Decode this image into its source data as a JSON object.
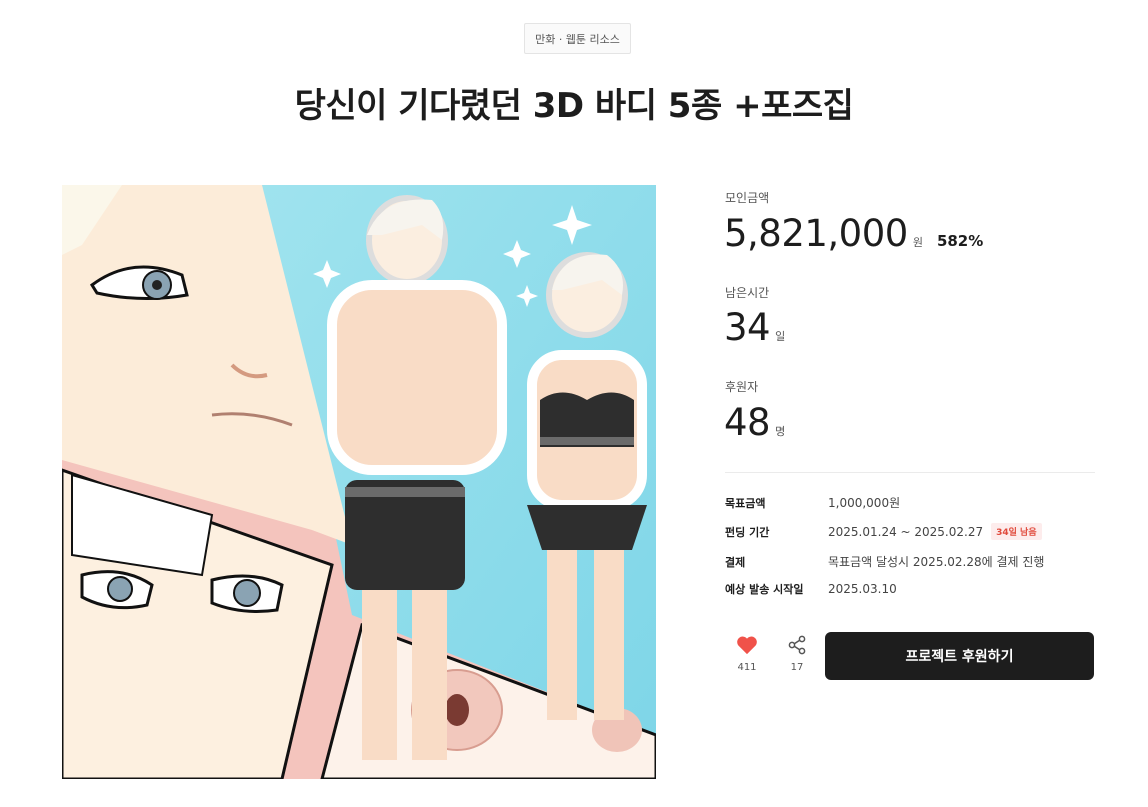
{
  "category": "만화 · 웹툰 리소스",
  "title": "당신이 기다렸던 3D 바디 5종 +포즈집",
  "stats": {
    "funding_label": "모인금액",
    "funding_amount": "5,821,000",
    "funding_unit": "원",
    "funding_percent": "582%",
    "time_label": "남은시간",
    "time_value": "34",
    "time_unit": "일",
    "backers_label": "후원자",
    "backers_value": "48",
    "backers_unit": "명"
  },
  "info": {
    "goal_key": "목표금액",
    "goal_val": "1,000,000원",
    "period_key": "펀딩 기간",
    "period_val": "2025.01.24 ~ 2025.02.27",
    "period_badge": "34일 남음",
    "payment_key": "결제",
    "payment_val": "목표금액 달성시 2025.02.28에 결제 진행",
    "ship_key": "예상 발송 시작일",
    "ship_val": "2025.03.10"
  },
  "actions": {
    "like_count": "411",
    "share_count": "17",
    "cta_label": "프로젝트 후원하기"
  },
  "colors": {
    "accent_heart": "#f0524a",
    "cta_bg": "#1d1d1d",
    "badge_bg": "#fdecec",
    "badge_text": "#e0493b"
  },
  "icons": [
    "heart-icon",
    "share-icon"
  ]
}
